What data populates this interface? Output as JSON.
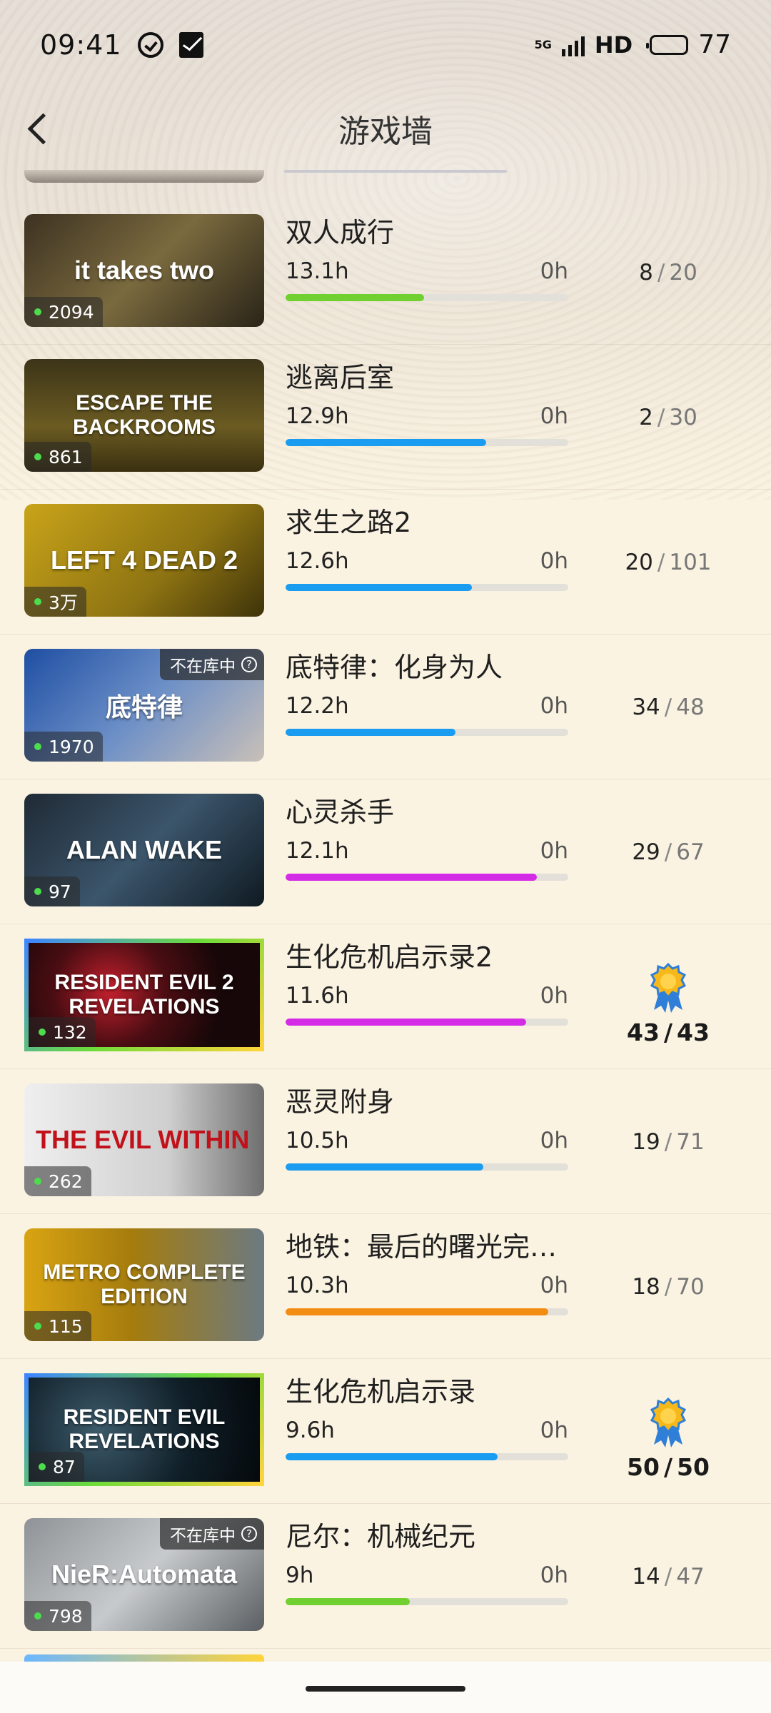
{
  "status_bar": {
    "time": "09:41",
    "network": "5G",
    "hd": "HD",
    "battery": "77"
  },
  "nav": {
    "title": "游戏墙"
  },
  "games": [
    {
      "name": "双人成行",
      "hours": "13.1h",
      "zero": "0h",
      "progress": 0.49,
      "bar_color": "#6fd02f",
      "badge": "2094",
      "achieved": "8",
      "total": "20",
      "completed": false,
      "owned": true,
      "cover_text": "it takes two",
      "cover_bg": "linear-gradient(135deg,#3d3222,#7a6a3e 50%,#2a2418)"
    },
    {
      "name": "逃离后室",
      "hours": "12.9h",
      "zero": "0h",
      "progress": 0.71,
      "bar_color": "#1a9cf0",
      "badge": "861",
      "achieved": "2",
      "total": "30",
      "completed": false,
      "owned": true,
      "cover_text": "ESCAPE THE BACKROOMS",
      "cover_bg": "linear-gradient(180deg,#3c3418,#6b5b22 60%,#3a3010)"
    },
    {
      "name": "求生之路2",
      "hours": "12.6h",
      "zero": "0h",
      "progress": 0.66,
      "bar_color": "#1a9cf0",
      "badge": "3万",
      "achieved": "20",
      "total": "101",
      "completed": false,
      "owned": true,
      "cover_text": "LEFT 4 DEAD 2",
      "cover_bg": "linear-gradient(135deg,#c9a419,#8d7312 60%,#3e330a)"
    },
    {
      "name": "底特律：化身为人",
      "hours": "12.2h",
      "zero": "0h",
      "progress": 0.6,
      "bar_color": "#1a9cf0",
      "badge": "1970",
      "achieved": "34",
      "total": "48",
      "completed": false,
      "owned": false,
      "not_owned_label": "不在库中",
      "cover_text": "底特律",
      "cover_bg": "linear-gradient(135deg,#1f4fa3,#6c8fc7 50%,#c9c0b8)"
    },
    {
      "name": "心灵杀手",
      "hours": "12.1h",
      "zero": "0h",
      "progress": 0.89,
      "bar_color": "#d42ce6",
      "badge": "97",
      "achieved": "29",
      "total": "67",
      "completed": false,
      "owned": true,
      "cover_text": "ALAN WAKE",
      "cover_bg": "linear-gradient(135deg,#1f2a35,#3b556b 50%,#0f1a22)"
    },
    {
      "name": "生化危机启示录2",
      "hours": "11.6h",
      "zero": "0h",
      "progress": 0.85,
      "bar_color": "#d42ce6",
      "badge": "132",
      "achieved": "43",
      "total": "43",
      "completed": true,
      "owned": true,
      "cover_text": "RESIDENT EVIL 2 REVELATIONS",
      "cover_bg": "radial-gradient(circle at 35% 45%,#c4202e,#4a0d12 35%,#170708 70%)"
    },
    {
      "name": "恶灵附身",
      "hours": "10.5h",
      "zero": "0h",
      "progress": 0.7,
      "bar_color": "#1a9cf0",
      "badge": "262",
      "achieved": "19",
      "total": "71",
      "completed": false,
      "owned": true,
      "cover_text": "THE EVIL WITHIN",
      "cover_bg": "linear-gradient(90deg,#efefef,#cfcfcf 60%,#6e6e6e)"
    },
    {
      "name": "地铁：最后的曙光完整版",
      "hours": "10.3h",
      "zero": "0h",
      "progress": 0.93,
      "bar_color": "#f28c12",
      "badge": "115",
      "achieved": "18",
      "total": "70",
      "completed": false,
      "owned": true,
      "cover_text": "METRO COMPLETE EDITION",
      "cover_bg": "linear-gradient(90deg,#d9a413,#a57c0d 45%,#6c7a82)"
    },
    {
      "name": "生化危机启示录",
      "hours": "9.6h",
      "zero": "0h",
      "progress": 0.75,
      "bar_color": "#1a9cf0",
      "badge": "87",
      "achieved": "50",
      "total": "50",
      "completed": true,
      "owned": true,
      "cover_text": "RESIDENT EVIL REVELATIONS",
      "cover_bg": "radial-gradient(circle at 30% 50%,#3d5b6b,#0f1e27 55%,#05090c)"
    },
    {
      "name": "尼尔：机械纪元",
      "hours": "9h",
      "zero": "0h",
      "progress": 0.44,
      "bar_color": "#6fd02f",
      "badge": "798",
      "achieved": "14",
      "total": "47",
      "completed": false,
      "owned": false,
      "not_owned_label": "不在库中",
      "cover_text": "NieR:Automata",
      "cover_bg": "linear-gradient(135deg,#8f9397,#c7cacc 50%,#5b5f63)"
    }
  ]
}
